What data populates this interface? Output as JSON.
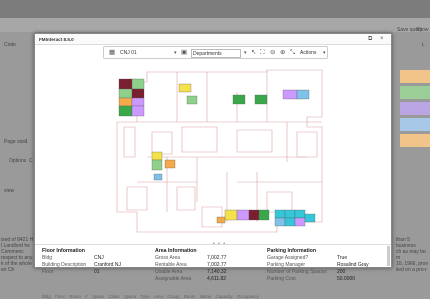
{
  "background": {
    "code": "Code",
    "page_size": "Page size:",
    "page_size_value": "1",
    "options": "Options",
    "options_value": "C",
    "view": "view",
    "left_text": [
      "ised of 8421 H",
      "l Landlord he",
      "Commenc",
      "respect to any",
      "k of the whole",
      "en Ch"
    ],
    "right_top": "Save query",
    "right_top2": "Show",
    "right_l": "L",
    "right_text": [
      "than 5 business",
      "ch as may be m",
      "10, 1966, prov",
      "lied on a pro-r"
    ]
  },
  "dialog": {
    "title": "FMInteract 8.5.0",
    "close": "×",
    "restore": "⧉",
    "toolbar": {
      "floor": "CNJ 01",
      "layer": "Departments",
      "actions": "Actions"
    },
    "floor_info": {
      "heading": "Floor Information",
      "rows": [
        {
          "k": "Bldg",
          "v": "CNJ"
        },
        {
          "k": "Building Description",
          "v": "Cranford NJ"
        },
        {
          "k": "Floor",
          "v": "01"
        }
      ]
    },
    "area_info": {
      "heading": "Area Information",
      "rows": [
        {
          "k": "Gross Area",
          "v": "7,002.77"
        },
        {
          "k": "Rentable Area",
          "v": "7,002.77"
        },
        {
          "k": "Usable Area",
          "v": "7,140.32"
        },
        {
          "k": "Assignable Area",
          "v": "4,611.82"
        }
      ]
    },
    "parking_info": {
      "heading": "Parking Information",
      "rows": [
        {
          "k": "Garage Assigned?",
          "v": "True"
        },
        {
          "k": "Parking Manager",
          "v": "Rosalind Gray"
        },
        {
          "k": "Number of Parking Spaces",
          "v": "200"
        },
        {
          "k": "Parking Cost",
          "v": "50.0000"
        }
      ]
    },
    "columns": "Bldg  Floor  Room #  Space Class  Space Type  Area  Group  Room Name  Capacity  Occupancy"
  },
  "colors": {
    "orange": "#f4a94b",
    "green": "#8fd18a",
    "blue": "#7fc1e8",
    "purple": "#cc99ff",
    "maroon": "#7a1f2f",
    "yellow": "#f3e24c",
    "cyan": "#35c7d9",
    "dkgreen": "#3aa84a"
  }
}
